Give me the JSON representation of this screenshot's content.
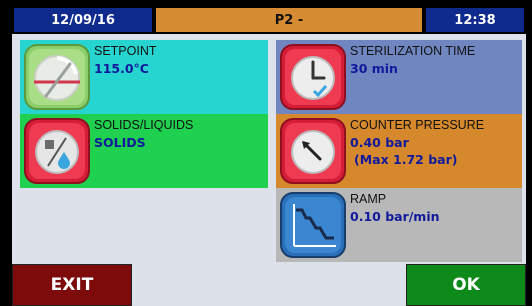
{
  "header": {
    "date": "12/09/16",
    "program": "P2 -",
    "time": "12:38"
  },
  "tiles": {
    "setpoint": {
      "label": "SETPOINT",
      "value": "115.0°C",
      "icon": "thermometer-dial-icon"
    },
    "solids_liquids": {
      "label": "SOLIDS/LIQUIDS",
      "value": "SOLIDS",
      "icon": "solid-liquid-drop-icon"
    },
    "sterilization_time": {
      "label": "STERILIZATION TIME",
      "value": "30 min",
      "icon": "clock-icon"
    },
    "counter_pressure": {
      "label": "COUNTER PRESSURE",
      "value": "0.40 bar",
      "max": "(Max 1.72 bar)",
      "icon": "pressure-gauge-icon"
    },
    "ramp": {
      "label": "RAMP",
      "value": "0.10 bar/min",
      "icon": "ramp-graph-icon"
    }
  },
  "buttons": {
    "exit": "EXIT",
    "ok": "OK"
  },
  "colors": {
    "header_blue": "#0d2a8c",
    "header_orange": "#d68c33",
    "setpoint_bg": "#27d5d0",
    "solids_bg": "#1fd14e",
    "steril_bg": "#6f86c0",
    "counter_bg": "#d6892c",
    "ramp_bg": "#b8b8b8",
    "exit_bg": "#7d0b0b",
    "ok_bg": "#0e8a1a"
  }
}
